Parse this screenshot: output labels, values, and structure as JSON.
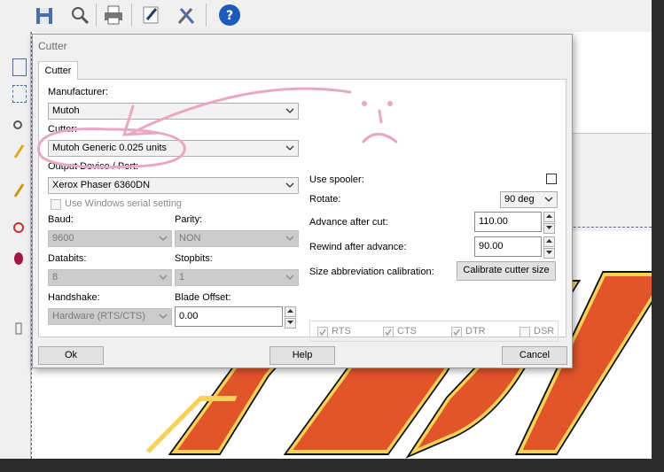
{
  "dialog": {
    "title": "Cutter",
    "tab_label": "Cutter"
  },
  "form": {
    "manufacturer_label": "Manufacturer:",
    "manufacturer_value": "Mutoh",
    "cutter_label": "Cutter:",
    "cutter_value": "Mutoh Generic 0.025 units",
    "output_label": "Output Device / Port:",
    "output_value": "Xerox Phaser 6360DN",
    "use_serial_label": "Use Windows serial setting",
    "baud_label": "Baud:",
    "baud_value": "9600",
    "parity_label": "Parity:",
    "parity_value": "NON",
    "databits_label": "Databits:",
    "databits_value": "8",
    "stopbits_label": "Stopbits:",
    "stopbits_value": "1",
    "handshake_label": "Handshake:",
    "handshake_value": "Hardware (RTS/CTS)",
    "blade_offset_label": "Blade Offset:",
    "blade_offset_value": "0.00",
    "use_spooler_label": "Use spooler:",
    "rotate_label": "Rotate:",
    "rotate_value": "90 deg",
    "advance_label": "Advance after cut:",
    "advance_value": "110.00",
    "rewind_label": "Rewind after advance:",
    "rewind_value": "90.00",
    "size_calib_label": "Size abbreviation calibration:",
    "calibrate_button": "Calibrate cutter size",
    "signals": [
      "RTS",
      "CTS",
      "DTR",
      "DSR"
    ]
  },
  "buttons": {
    "ok": "Ok",
    "help": "Help",
    "cancel": "Cancel"
  },
  "colors": {
    "annotation_pink": "#e8a8c4",
    "artwork_orange": "#e2552a",
    "artwork_yellow": "#f7d25a",
    "help_icon_blue": "#1e5bb8"
  },
  "icons": {
    "toolbar": [
      "save-icon",
      "zoom-icon",
      "print-icon",
      "edit-icon",
      "tools-icon",
      "help-icon"
    ]
  }
}
